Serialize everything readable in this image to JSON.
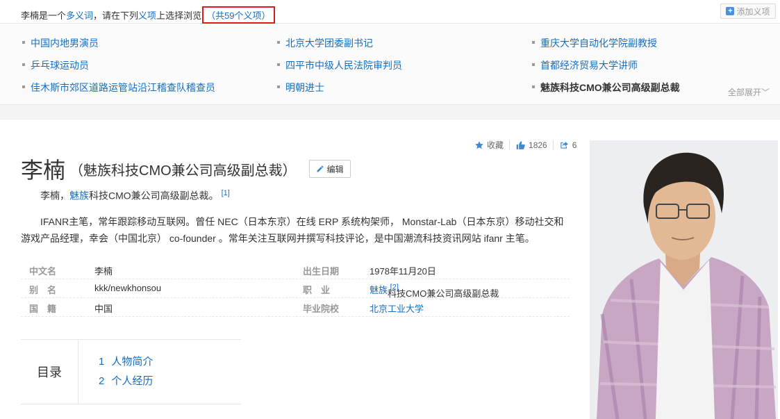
{
  "topbar": {
    "prefix": "李楠是一个",
    "polysemy_link": "多义词",
    "middle": "，请在下列",
    "sense_link": "义项",
    "suffix": "上选择浏览",
    "count": "（共59个义项）",
    "add_button": "添加义项"
  },
  "senses": [
    "中国内地男演员",
    "北京大学团委副书记",
    "重庆大学自动化学院副教授",
    "乒乓球运动员",
    "四平市中级人民法院审判员",
    "首都经济贸易大学讲师",
    "佳木斯市郊区道路运管站沿江稽查队稽查员",
    "明朝进士",
    "魅族科技CMO兼公司高级副总裁"
  ],
  "expand_label": "全部展开",
  "tools": {
    "collect": "收藏",
    "likes": "1826",
    "shares": "6"
  },
  "title": {
    "main": "李楠",
    "sub": "（魅族科技CMO兼公司高级副总裁）",
    "edit": "编辑"
  },
  "summary1": {
    "a": "李楠，",
    "link": "魅族",
    "b": "科技CMO兼公司高级副总裁。",
    "ref": "[1]"
  },
  "summary2_line1": "IFANR主笔，常年跟踪移动互联网。曾任 NEC（日本东京）在线 ERP 系统构架师， Monstar-Lab（日本东京）移动社交和",
  "summary2_line2": "游戏产品经理，幸会（中国北京） co-founder 。常年关注互联网并撰写科技评论，是中国潮流科技资讯网站 ifanr 主笔。",
  "basic": {
    "chinese_name_label": "中文名",
    "chinese_name": "李楠",
    "alias_label": "别　名",
    "alias": "kkk/newkhonsou",
    "nationality_label": "国　籍",
    "nationality": "中国",
    "birth_label": "出生日期",
    "birth": "1978年11月20日",
    "job_label": "职　业",
    "job_link": "魅族",
    "job_rest": "科技CMO兼公司高级副总裁",
    "job_ref": "[2]",
    "school_label": "毕业院校",
    "school": "北京工业大学"
  },
  "toc": {
    "label": "目录",
    "items": [
      {
        "num": "1",
        "label": "人物简介"
      },
      {
        "num": "2",
        "label": "个人经历"
      }
    ]
  },
  "colors": {
    "link": "#136ec2",
    "highlight_box": "#e0191f"
  }
}
